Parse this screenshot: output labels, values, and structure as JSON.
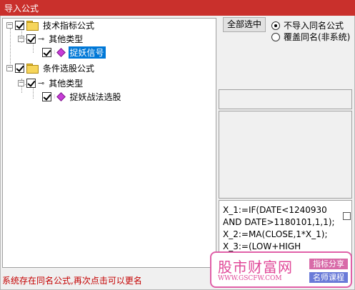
{
  "window": {
    "title": "导入公式"
  },
  "tree": {
    "root1": {
      "label": "技术指标公式"
    },
    "root1_child": {
      "label": "其他类型"
    },
    "root1_leaf": {
      "label": "捉妖信号"
    },
    "root2": {
      "label": "条件选股公式"
    },
    "root2_child": {
      "label": "其他类型"
    },
    "root2_leaf": {
      "label": "捉妖战法选股"
    }
  },
  "controls": {
    "select_all_label": "全部选中",
    "radio_skip_label": "不导入同名公式",
    "radio_overwrite_label": "覆盖同名(非系统)"
  },
  "code": {
    "lines": [
      "X_1:=IF(DATE<1240930",
      "AND DATE>1180101,1,1);",
      "X_2:=MA(CLOSE,1*X_1);",
      "X_3:=(LOW+HIGH"
    ]
  },
  "status": {
    "message": "系统存在同名公式,再次点击可以更名"
  },
  "watermark": {
    "brand": "股市财富网",
    "url": "WWW.GSCFW.COM",
    "tag1": "指标分享",
    "tag2": "名师课程"
  },
  "colors": {
    "titlebar": "#c9302c",
    "selection": "#0078d7",
    "status_text": "#c40000",
    "watermark": "#e04898"
  }
}
